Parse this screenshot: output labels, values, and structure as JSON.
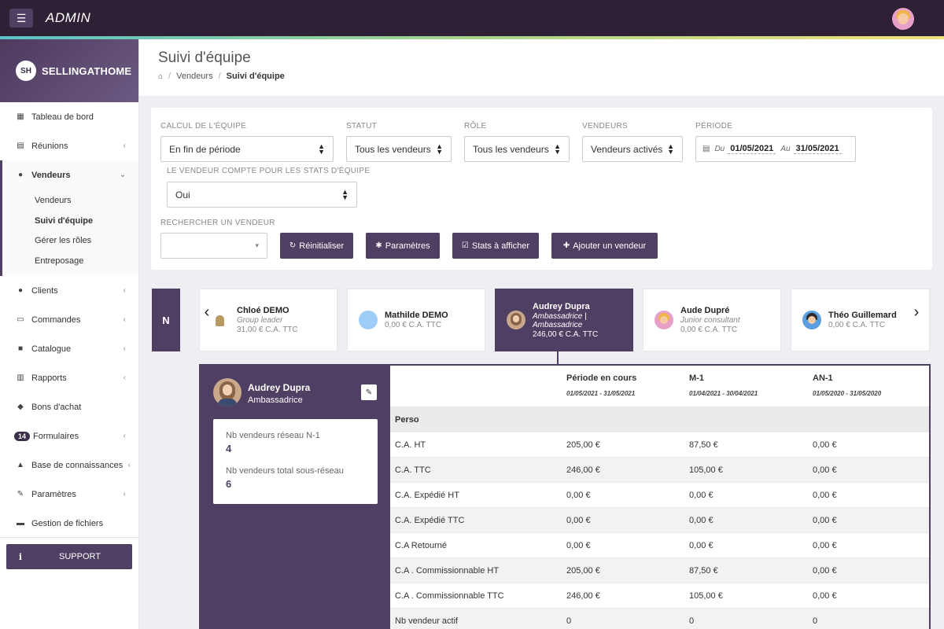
{
  "topbar": {
    "title": "ADMIN"
  },
  "sidebar": {
    "logo_mark": "SH",
    "logo_text": "SELLINGATHOME",
    "items": [
      {
        "label": "Tableau de bord",
        "icon": "dashboard-icon"
      },
      {
        "label": "Réunions",
        "icon": "calendar-icon"
      },
      {
        "label": "Vendeurs",
        "icon": "users-icon"
      },
      {
        "label": "Clients",
        "icon": "users-icon"
      },
      {
        "label": "Commandes",
        "icon": "credit-card-icon"
      },
      {
        "label": "Catalogue",
        "icon": "book-icon"
      },
      {
        "label": "Rapports",
        "icon": "bar-chart-icon"
      },
      {
        "label": "Bons d'achat",
        "icon": "tag-icon"
      },
      {
        "label": "Formulaires",
        "badge": "14"
      },
      {
        "label": "Base de connaissances",
        "icon": "graduation-cap-icon"
      },
      {
        "label": "Paramètres",
        "icon": "wrench-icon"
      },
      {
        "label": "Gestion de fichiers",
        "icon": "folder-icon"
      }
    ],
    "subitems": [
      "Vendeurs",
      "Suivi d'équipe",
      "Gérer les rôles",
      "Entreposage"
    ],
    "support": "SUPPORT"
  },
  "header": {
    "title": "Suivi d'équipe",
    "breadcrumb": [
      "Vendeurs",
      "Suivi d'équipe"
    ]
  },
  "filters": {
    "calc_label": "CALCUL DE L'ÉQUIPE",
    "calc_value": "En fin de période",
    "statut_label": "STATUT",
    "statut_value": "Tous les vendeurs",
    "role_label": "RÔLE",
    "role_value": "Tous les vendeurs",
    "vendeurs_label": "VENDEURS",
    "vendeurs_value": "Vendeurs activés",
    "periode_label": "PÉRIODE",
    "du_label": "Du",
    "du_value": "01/05/2021",
    "au_label": "Au",
    "au_value": "31/05/2021",
    "compte_label": "LE VENDEUR COMPTE POUR LES STATS D'ÉQUIPE",
    "compte_value": "Oui",
    "search_label": "RECHERCHER UN VENDEUR",
    "btn_reset": "Réinitialiser",
    "btn_params": "Paramètres",
    "btn_stats": "Stats à afficher",
    "btn_add": "Ajouter un vendeur"
  },
  "carousel": {
    "tab": "N",
    "cards": [
      {
        "name": "Chloé DEMO",
        "role": "Group leader",
        "ca": "31,00 € C.A. TTC"
      },
      {
        "name": "Mathilde DEMO",
        "role": "",
        "ca": "0,00 € C.A. TTC"
      },
      {
        "name": "Audrey Dupra",
        "role": "Ambassadrice | Ambassadrice",
        "ca": "246,00 € C.A. TTC"
      },
      {
        "name": "Aude Dupré",
        "role": "Junior consultant",
        "ca": "0,00 € C.A. TTC"
      },
      {
        "name": "Théo Guillemard",
        "role": "",
        "ca": "0,00 € C.A. TTC"
      }
    ]
  },
  "detail": {
    "name": "Audrey Dupra",
    "role": "Ambassadrice",
    "stats": [
      {
        "label": "Nb vendeurs réseau N-1",
        "value": "4"
      },
      {
        "label": "Nb vendeurs total sous-réseau",
        "value": "6"
      }
    ],
    "columns": [
      {
        "title": "Période en cours",
        "dates": "01/05/2021 - 31/05/2021"
      },
      {
        "title": "M-1",
        "dates": "01/04/2021 - 30/04/2021"
      },
      {
        "title": "AN-1",
        "dates": "01/05/2020 - 31/05/2020"
      }
    ],
    "section": "Perso",
    "rows": [
      {
        "label": "C.A. HT",
        "v": [
          "205,00 €",
          "87,50 €",
          "0,00 €"
        ]
      },
      {
        "label": "C.A. TTC",
        "v": [
          "246,00 €",
          "105,00 €",
          "0,00 €"
        ]
      },
      {
        "label": "C.A. Expédié HT",
        "v": [
          "0,00 €",
          "0,00 €",
          "0,00 €"
        ]
      },
      {
        "label": "C.A. Expédié TTC",
        "v": [
          "0,00 €",
          "0,00 €",
          "0,00 €"
        ]
      },
      {
        "label": "C.A Retourné",
        "v": [
          "0,00 €",
          "0,00 €",
          "0,00 €"
        ]
      },
      {
        "label": "C.A . Commissionnable HT",
        "v": [
          "205,00 €",
          "87,50 €",
          "0,00 €"
        ]
      },
      {
        "label": "C.A . Commissionnable TTC",
        "v": [
          "246,00 €",
          "105,00 €",
          "0,00 €"
        ]
      },
      {
        "label": "Nb vendeur actif",
        "v": [
          "0",
          "0",
          "0"
        ]
      }
    ]
  }
}
